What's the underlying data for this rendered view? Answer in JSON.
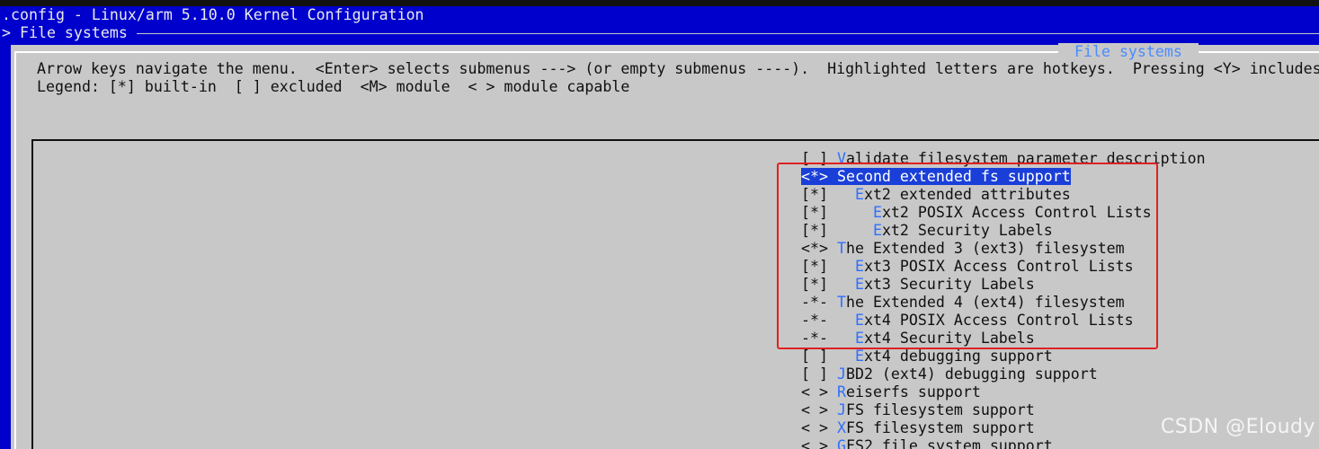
{
  "title_bar": {
    "text": ".config - Linux/arm 5.10.0 Kernel Configuration"
  },
  "breadcrumb": {
    "text": "> File systems "
  },
  "dialog": {
    "title": " File systems ",
    "help_line_1": "Arrow keys navigate the menu.  <Enter> selects submenus ---> (or empty submenus ----).  Highlighted letters are hotkeys.  Pressing <Y> includes",
    "help_line_2": "Legend: [*] built-in  [ ] excluded  <M> module  < > module capable"
  },
  "menu": {
    "selected_index": 1,
    "items": [
      {
        "prefix": "[ ] ",
        "hotkey": "V",
        "rest": "alidate filesystem parameter description"
      },
      {
        "prefix": "<*> ",
        "hotkey": "S",
        "rest": "econd extended fs support"
      },
      {
        "prefix": "[*]   ",
        "hotkey": "E",
        "rest": "xt2 extended attributes"
      },
      {
        "prefix": "[*]     ",
        "hotkey": "E",
        "rest": "xt2 POSIX Access Control Lists"
      },
      {
        "prefix": "[*]     ",
        "hotkey": "E",
        "rest": "xt2 Security Labels"
      },
      {
        "prefix": "<*> ",
        "hotkey": "T",
        "rest": "he Extended 3 (ext3) filesystem"
      },
      {
        "prefix": "[*]   ",
        "hotkey": "E",
        "rest": "xt3 POSIX Access Control Lists"
      },
      {
        "prefix": "[*]   ",
        "hotkey": "E",
        "rest": "xt3 Security Labels"
      },
      {
        "prefix": "-*- ",
        "hotkey": "T",
        "rest": "he Extended 4 (ext4) filesystem"
      },
      {
        "prefix": "-*-   ",
        "hotkey": "E",
        "rest": "xt4 POSIX Access Control Lists"
      },
      {
        "prefix": "-*-   ",
        "hotkey": "E",
        "rest": "xt4 Security Labels"
      },
      {
        "prefix": "[ ]   ",
        "hotkey": "E",
        "rest": "xt4 debugging support"
      },
      {
        "prefix": "[ ] ",
        "hotkey": "J",
        "rest": "BD2 (ext4) debugging support"
      },
      {
        "prefix": "< > ",
        "hotkey": "R",
        "rest": "eiserfs support"
      },
      {
        "prefix": "< > ",
        "hotkey": "J",
        "rest": "FS filesystem support"
      },
      {
        "prefix": "< > ",
        "hotkey": "X",
        "rest": "FS filesystem support"
      },
      {
        "prefix": "< > ",
        "hotkey": "G",
        "rest": "FS2 file system support"
      }
    ]
  },
  "annotation": {
    "color": "#e02020"
  },
  "watermark": {
    "text": "CSDN @Eloudy"
  },
  "colors": {
    "background_blue": "#0000cd",
    "dialog_gray": "#c8c8c8",
    "hotkey_blue": "#2f6fff",
    "selection_blue": "#1a3fd8"
  }
}
